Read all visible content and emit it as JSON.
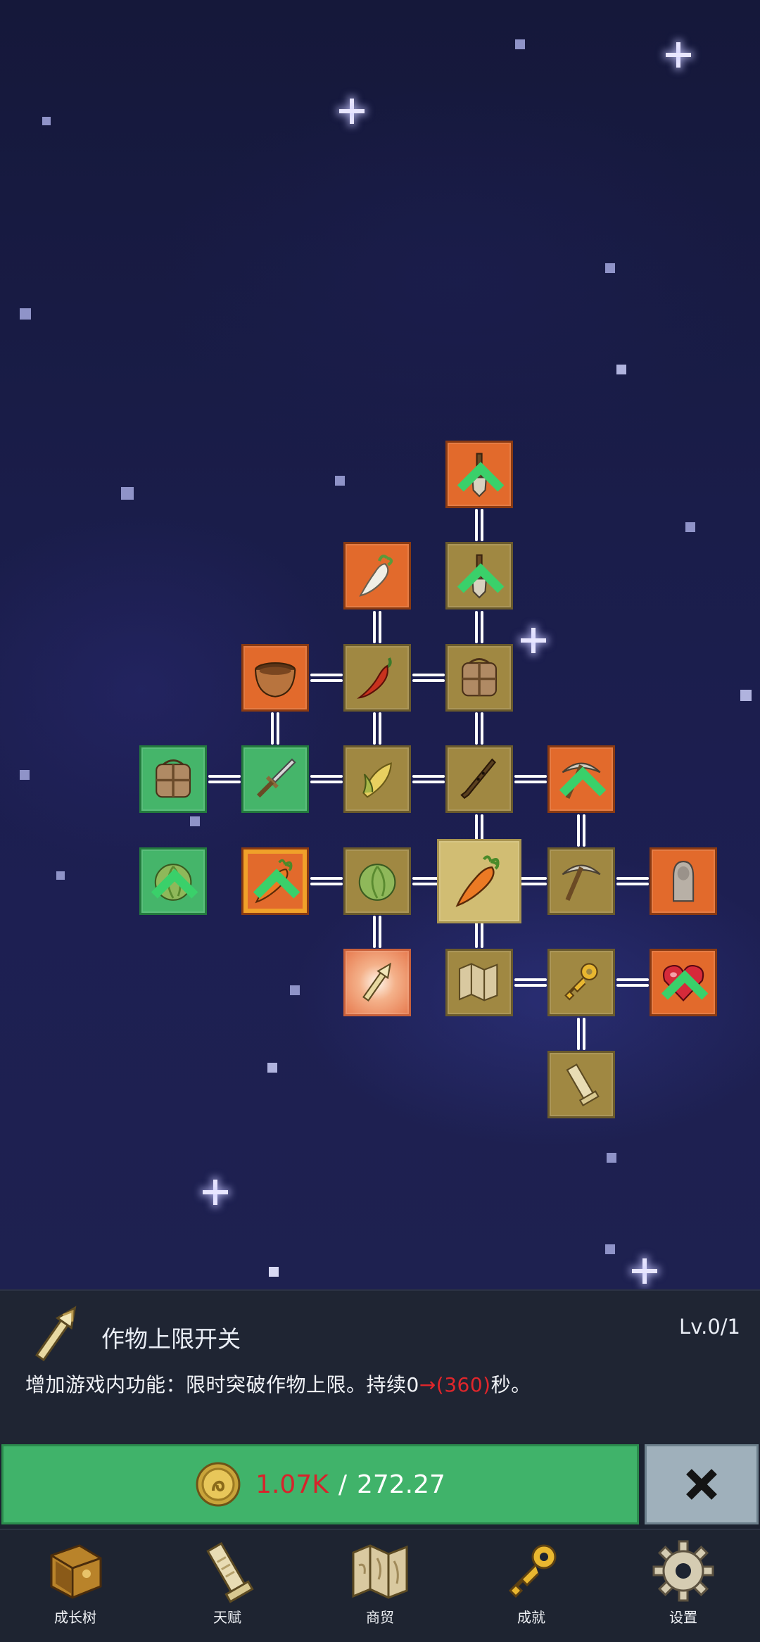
{
  "skill_tree": {
    "nodes": [
      {
        "id": "shovel-top",
        "icon": "shovel-icon",
        "color": "orange",
        "upgradable": true
      },
      {
        "id": "radish",
        "icon": "radish-icon",
        "color": "orange",
        "upgradable": false
      },
      {
        "id": "shovel",
        "icon": "shovel-icon",
        "color": "olive",
        "upgradable": true
      },
      {
        "id": "pot",
        "icon": "clay-pot-icon",
        "color": "orange",
        "upgradable": false
      },
      {
        "id": "chili",
        "icon": "chili-pepper-icon",
        "color": "olive",
        "upgradable": false
      },
      {
        "id": "backpack",
        "icon": "backpack-icon",
        "color": "olive",
        "upgradable": false
      },
      {
        "id": "backpack-green",
        "icon": "backpack-icon",
        "color": "green",
        "upgradable": false
      },
      {
        "id": "sword",
        "icon": "sword-icon",
        "color": "green",
        "upgradable": false
      },
      {
        "id": "corn",
        "icon": "corn-icon",
        "color": "olive",
        "upgradable": false
      },
      {
        "id": "flute",
        "icon": "flute-icon",
        "color": "olive",
        "upgradable": false
      },
      {
        "id": "pickaxe-orange",
        "icon": "pickaxe-icon",
        "color": "orange",
        "upgradable": true
      },
      {
        "id": "cabbage-green",
        "icon": "cabbage-icon",
        "color": "green",
        "upgradable": true
      },
      {
        "id": "carrot-framed",
        "icon": "carrot-icon",
        "color": "orange",
        "upgradable": true
      },
      {
        "id": "cabbage",
        "icon": "cabbage-icon",
        "color": "olive",
        "upgradable": false
      },
      {
        "id": "carrot-center",
        "icon": "carrot-icon",
        "color": "selected",
        "upgradable": false
      },
      {
        "id": "pickaxe",
        "icon": "pickaxe-icon",
        "color": "olive",
        "upgradable": false
      },
      {
        "id": "statue",
        "icon": "statue-icon",
        "color": "orange",
        "upgradable": false
      },
      {
        "id": "torch",
        "icon": "torch-icon",
        "color": "glow",
        "upgradable": false
      },
      {
        "id": "map",
        "icon": "map-icon",
        "color": "olive",
        "upgradable": false
      },
      {
        "id": "key",
        "icon": "key-icon",
        "color": "olive",
        "upgradable": false
      },
      {
        "id": "heart",
        "icon": "heart-icon",
        "color": "orange",
        "upgradable": true
      },
      {
        "id": "scroll",
        "icon": "scroll-icon",
        "color": "olive",
        "upgradable": false
      }
    ]
  },
  "info": {
    "icon": "torch-icon",
    "name": "作物上限开关",
    "level": "Lv.0/1",
    "desc_prefix": "增加游戏内功能：限时突破作物上限。持续0",
    "desc_arrow": "→",
    "desc_value": "(360)",
    "desc_suffix": "秒。"
  },
  "upgrade": {
    "have": "1.07K",
    "separator": "/",
    "need": "272.27",
    "button_color": "#40b36a"
  },
  "close_icon": "close-icon",
  "nav": [
    {
      "label": "成长树",
      "icon": "book-icon"
    },
    {
      "label": "天赋",
      "icon": "scroll-icon"
    },
    {
      "label": "商贸",
      "icon": "map-icon"
    },
    {
      "label": "成就",
      "icon": "key-icon"
    },
    {
      "label": "设置",
      "icon": "gear-icon"
    }
  ]
}
